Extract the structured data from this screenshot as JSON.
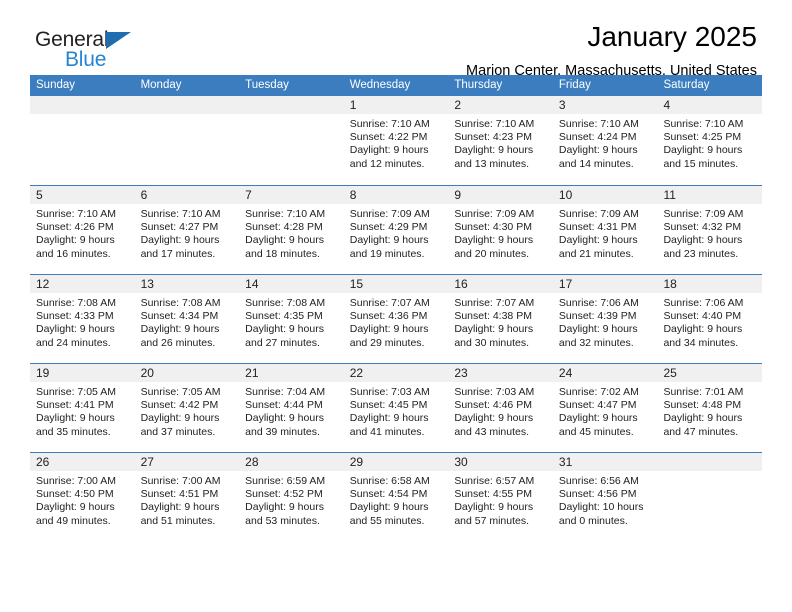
{
  "brand": {
    "name_part1": "General",
    "name_part2": "Blue",
    "triangle_color": "#1f6cb0",
    "blue_color": "#2585d3"
  },
  "header": {
    "title": "January 2025",
    "subtitle": "Marion Center, Massachusetts, United States"
  },
  "theme": {
    "header_blue": "#3b7dbf",
    "daynum_band": "#f0f0f0"
  },
  "weekdays": [
    "Sunday",
    "Monday",
    "Tuesday",
    "Wednesday",
    "Thursday",
    "Friday",
    "Saturday"
  ],
  "weeks": [
    [
      {
        "day": "",
        "lines": []
      },
      {
        "day": "",
        "lines": []
      },
      {
        "day": "",
        "lines": []
      },
      {
        "day": "1",
        "lines": [
          "Sunrise: 7:10 AM",
          "Sunset: 4:22 PM",
          "Daylight: 9 hours",
          "and 12 minutes."
        ]
      },
      {
        "day": "2",
        "lines": [
          "Sunrise: 7:10 AM",
          "Sunset: 4:23 PM",
          "Daylight: 9 hours",
          "and 13 minutes."
        ]
      },
      {
        "day": "3",
        "lines": [
          "Sunrise: 7:10 AM",
          "Sunset: 4:24 PM",
          "Daylight: 9 hours",
          "and 14 minutes."
        ]
      },
      {
        "day": "4",
        "lines": [
          "Sunrise: 7:10 AM",
          "Sunset: 4:25 PM",
          "Daylight: 9 hours",
          "and 15 minutes."
        ]
      }
    ],
    [
      {
        "day": "5",
        "lines": [
          "Sunrise: 7:10 AM",
          "Sunset: 4:26 PM",
          "Daylight: 9 hours",
          "and 16 minutes."
        ]
      },
      {
        "day": "6",
        "lines": [
          "Sunrise: 7:10 AM",
          "Sunset: 4:27 PM",
          "Daylight: 9 hours",
          "and 17 minutes."
        ]
      },
      {
        "day": "7",
        "lines": [
          "Sunrise: 7:10 AM",
          "Sunset: 4:28 PM",
          "Daylight: 9 hours",
          "and 18 minutes."
        ]
      },
      {
        "day": "8",
        "lines": [
          "Sunrise: 7:09 AM",
          "Sunset: 4:29 PM",
          "Daylight: 9 hours",
          "and 19 minutes."
        ]
      },
      {
        "day": "9",
        "lines": [
          "Sunrise: 7:09 AM",
          "Sunset: 4:30 PM",
          "Daylight: 9 hours",
          "and 20 minutes."
        ]
      },
      {
        "day": "10",
        "lines": [
          "Sunrise: 7:09 AM",
          "Sunset: 4:31 PM",
          "Daylight: 9 hours",
          "and 21 minutes."
        ]
      },
      {
        "day": "11",
        "lines": [
          "Sunrise: 7:09 AM",
          "Sunset: 4:32 PM",
          "Daylight: 9 hours",
          "and 23 minutes."
        ]
      }
    ],
    [
      {
        "day": "12",
        "lines": [
          "Sunrise: 7:08 AM",
          "Sunset: 4:33 PM",
          "Daylight: 9 hours",
          "and 24 minutes."
        ]
      },
      {
        "day": "13",
        "lines": [
          "Sunrise: 7:08 AM",
          "Sunset: 4:34 PM",
          "Daylight: 9 hours",
          "and 26 minutes."
        ]
      },
      {
        "day": "14",
        "lines": [
          "Sunrise: 7:08 AM",
          "Sunset: 4:35 PM",
          "Daylight: 9 hours",
          "and 27 minutes."
        ]
      },
      {
        "day": "15",
        "lines": [
          "Sunrise: 7:07 AM",
          "Sunset: 4:36 PM",
          "Daylight: 9 hours",
          "and 29 minutes."
        ]
      },
      {
        "day": "16",
        "lines": [
          "Sunrise: 7:07 AM",
          "Sunset: 4:38 PM",
          "Daylight: 9 hours",
          "and 30 minutes."
        ]
      },
      {
        "day": "17",
        "lines": [
          "Sunrise: 7:06 AM",
          "Sunset: 4:39 PM",
          "Daylight: 9 hours",
          "and 32 minutes."
        ]
      },
      {
        "day": "18",
        "lines": [
          "Sunrise: 7:06 AM",
          "Sunset: 4:40 PM",
          "Daylight: 9 hours",
          "and 34 minutes."
        ]
      }
    ],
    [
      {
        "day": "19",
        "lines": [
          "Sunrise: 7:05 AM",
          "Sunset: 4:41 PM",
          "Daylight: 9 hours",
          "and 35 minutes."
        ]
      },
      {
        "day": "20",
        "lines": [
          "Sunrise: 7:05 AM",
          "Sunset: 4:42 PM",
          "Daylight: 9 hours",
          "and 37 minutes."
        ]
      },
      {
        "day": "21",
        "lines": [
          "Sunrise: 7:04 AM",
          "Sunset: 4:44 PM",
          "Daylight: 9 hours",
          "and 39 minutes."
        ]
      },
      {
        "day": "22",
        "lines": [
          "Sunrise: 7:03 AM",
          "Sunset: 4:45 PM",
          "Daylight: 9 hours",
          "and 41 minutes."
        ]
      },
      {
        "day": "23",
        "lines": [
          "Sunrise: 7:03 AM",
          "Sunset: 4:46 PM",
          "Daylight: 9 hours",
          "and 43 minutes."
        ]
      },
      {
        "day": "24",
        "lines": [
          "Sunrise: 7:02 AM",
          "Sunset: 4:47 PM",
          "Daylight: 9 hours",
          "and 45 minutes."
        ]
      },
      {
        "day": "25",
        "lines": [
          "Sunrise: 7:01 AM",
          "Sunset: 4:48 PM",
          "Daylight: 9 hours",
          "and 47 minutes."
        ]
      }
    ],
    [
      {
        "day": "26",
        "lines": [
          "Sunrise: 7:00 AM",
          "Sunset: 4:50 PM",
          "Daylight: 9 hours",
          "and 49 minutes."
        ]
      },
      {
        "day": "27",
        "lines": [
          "Sunrise: 7:00 AM",
          "Sunset: 4:51 PM",
          "Daylight: 9 hours",
          "and 51 minutes."
        ]
      },
      {
        "day": "28",
        "lines": [
          "Sunrise: 6:59 AM",
          "Sunset: 4:52 PM",
          "Daylight: 9 hours",
          "and 53 minutes."
        ]
      },
      {
        "day": "29",
        "lines": [
          "Sunrise: 6:58 AM",
          "Sunset: 4:54 PM",
          "Daylight: 9 hours",
          "and 55 minutes."
        ]
      },
      {
        "day": "30",
        "lines": [
          "Sunrise: 6:57 AM",
          "Sunset: 4:55 PM",
          "Daylight: 9 hours",
          "and 57 minutes."
        ]
      },
      {
        "day": "31",
        "lines": [
          "Sunrise: 6:56 AM",
          "Sunset: 4:56 PM",
          "Daylight: 10 hours",
          "and 0 minutes."
        ]
      },
      {
        "day": "",
        "lines": []
      }
    ]
  ]
}
